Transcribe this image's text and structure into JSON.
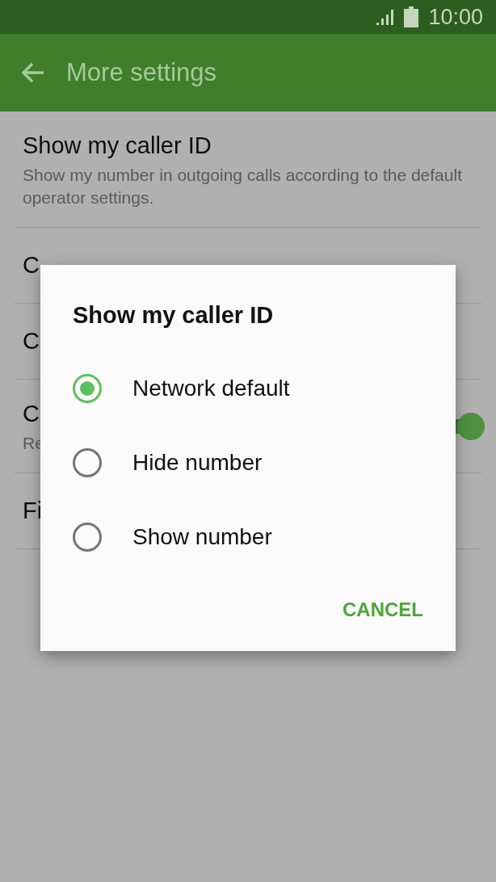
{
  "status_bar": {
    "time": "10:00"
  },
  "toolbar": {
    "title": "More settings"
  },
  "settings": [
    {
      "title": "Show my caller ID",
      "subtitle": "Show my number in outgoing calls according to the default operator settings."
    },
    {
      "title": "C"
    },
    {
      "title": "C"
    },
    {
      "title": "C",
      "subtitle": "Re",
      "switch": {
        "on": true
      }
    },
    {
      "title": "Fi"
    }
  ],
  "dialog": {
    "title": "Show my caller ID",
    "options": [
      {
        "label": "Network default",
        "selected": true
      },
      {
        "label": "Hide number",
        "selected": false
      },
      {
        "label": "Show number",
        "selected": false
      }
    ],
    "buttons": [
      "CANCEL"
    ]
  }
}
